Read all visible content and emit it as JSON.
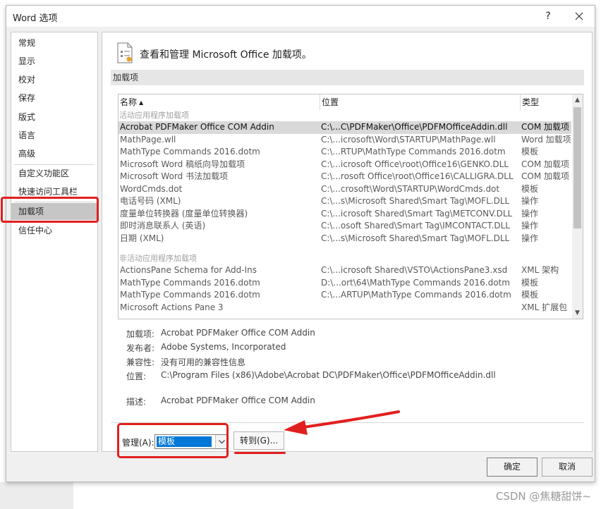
{
  "window": {
    "title": "Word 选项",
    "help_label": "?"
  },
  "sidebar": {
    "items": [
      {
        "label": "常规"
      },
      {
        "label": "显示"
      },
      {
        "label": "校对"
      },
      {
        "label": "保存"
      },
      {
        "label": "版式"
      },
      {
        "label": "语言"
      },
      {
        "label": "高级"
      },
      {
        "label": "自定义功能区"
      },
      {
        "label": "快速访问工具栏"
      },
      {
        "label": "加载项",
        "selected": true
      },
      {
        "label": "信任中心"
      }
    ]
  },
  "main": {
    "header": "查看和管理 Microsoft Office 加载项。",
    "section_title": "加载项",
    "columns": {
      "name": "名称",
      "location": "位置",
      "type": "类型"
    },
    "active_group_label": "活动应用程序加载项",
    "inactive_group_label": "非活动应用程序加载项",
    "active_rows": [
      {
        "name": "Acrobat PDFMaker Office COM Addin",
        "location": "C:\\...C\\PDFMaker\\Office\\PDFMOfficeAddin.dll",
        "type": "COM 加载项",
        "selected": true
      },
      {
        "name": "MathPage.wll",
        "location": "C:\\...icrosoft\\Word\\STARTUP\\MathPage.wll",
        "type": "Word 加载项"
      },
      {
        "name": "MathType Commands 2016.dotm",
        "location": "C:\\...RTUP\\MathType Commands 2016.dotm",
        "type": "模板"
      },
      {
        "name": "Microsoft Word 稿纸向导加载项",
        "location": "C:\\...icrosoft Office\\root\\Office16\\GENKO.DLL",
        "type": "COM 加载项"
      },
      {
        "name": "Microsoft Word 书法加载项",
        "location": "C:\\...rosoft Office\\root\\Office16\\CALLIGRA.DLL",
        "type": "COM 加载项"
      },
      {
        "name": "WordCmds.dot",
        "location": "C:\\...crosoft\\Word\\STARTUP\\WordCmds.dot",
        "type": "模板"
      },
      {
        "name": "电话号码 (XML)",
        "location": "C:\\...s\\Microsoft Shared\\Smart Tag\\MOFL.DLL",
        "type": "操作"
      },
      {
        "name": "度量单位转换器 (度量单位转换器)",
        "location": "C:\\...icrosoft Shared\\Smart Tag\\METCONV.DLL",
        "type": "操作"
      },
      {
        "name": "即时消息联系人 (英语)",
        "location": "C:\\...osoft Shared\\Smart Tag\\IMCONTACT.DLL",
        "type": "操作"
      },
      {
        "name": "日期 (XML)",
        "location": "C:\\...s\\Microsoft Shared\\Smart Tag\\MOFL.DLL",
        "type": "操作"
      }
    ],
    "inactive_rows": [
      {
        "name": "ActionsPane Schema for Add-Ins",
        "location": "C:\\...icrosoft Shared\\VSTO\\ActionsPane3.xsd",
        "type": "XML 架构"
      },
      {
        "name": "MathType Commands 2016.dotm",
        "location": "D:\\...ort\\64\\MathType Commands 2016.dotm",
        "type": "模板"
      },
      {
        "name": "MathType Commands 2016.dotm",
        "location": "C:\\...ARTUP\\MathType Commands 2016.dotm",
        "type": "模板"
      },
      {
        "name": "Microsoft Actions Pane 3",
        "location": "",
        "type": "XML 扩展包"
      }
    ],
    "details": [
      {
        "label": "加载项:",
        "value": "Acrobat PDFMaker Office COM Addin"
      },
      {
        "label": "发布者:",
        "value": "Adobe Systems, Incorporated"
      },
      {
        "label": "兼容性:",
        "value": "没有可用的兼容性信息"
      },
      {
        "label": "位置:",
        "value": "C:\\Program Files (x86)\\Adobe\\Acrobat DC\\PDFMaker\\Office\\PDFMOfficeAddin.dll"
      },
      {
        "label": "描述:",
        "value": "Acrobat PDFMaker Office COM Addin"
      }
    ],
    "manage_label": "管理(A):",
    "manage_value": "模板",
    "goto_label": "转到(G)..."
  },
  "buttons": {
    "ok": "确定",
    "cancel": "取消"
  },
  "watermark": "CSDN @焦糖甜饼~",
  "colors": {
    "annotation": "#e0201f",
    "selection": "#0078d7"
  }
}
